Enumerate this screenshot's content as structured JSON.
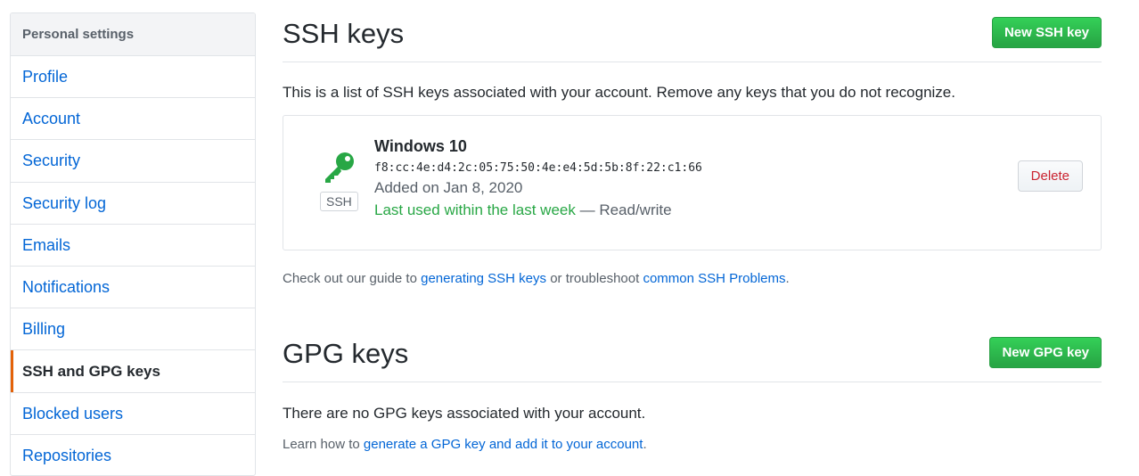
{
  "sidebar": {
    "header": "Personal settings",
    "items": [
      {
        "label": "Profile"
      },
      {
        "label": "Account"
      },
      {
        "label": "Security"
      },
      {
        "label": "Security log"
      },
      {
        "label": "Emails"
      },
      {
        "label": "Notifications"
      },
      {
        "label": "Billing"
      },
      {
        "label": "SSH and GPG keys",
        "selected": true
      },
      {
        "label": "Blocked users"
      },
      {
        "label": "Repositories"
      }
    ]
  },
  "ssh": {
    "title": "SSH keys",
    "new_button": "New SSH key",
    "intro": "This is a list of SSH keys associated with your account. Remove any keys that you do not recognize.",
    "key": {
      "icon": "key-icon",
      "badge": "SSH",
      "title": "Windows 10",
      "fingerprint": "f8:cc:4e:d4:2c:05:75:50:4e:e4:5d:5b:8f:22:c1:66",
      "added": "Added on Jan 8, 2020",
      "last_used": "Last used within the last week",
      "access": "— Read/write",
      "delete_label": "Delete"
    },
    "guide": {
      "prefix": "Check out our guide to ",
      "link1": "generating SSH keys",
      "middle": " or troubleshoot ",
      "link2": "common SSH Problems",
      "suffix": "."
    }
  },
  "gpg": {
    "title": "GPG keys",
    "new_button": "New GPG key",
    "empty": "There are no GPG keys associated with your account.",
    "learn": {
      "prefix": "Learn how to ",
      "link": "generate a GPG key and add it to your account",
      "suffix": "."
    }
  },
  "colors": {
    "accent_green": "#28a745",
    "link_blue": "#0366d6",
    "selected_bar": "#e36209",
    "danger": "#cb2431"
  }
}
